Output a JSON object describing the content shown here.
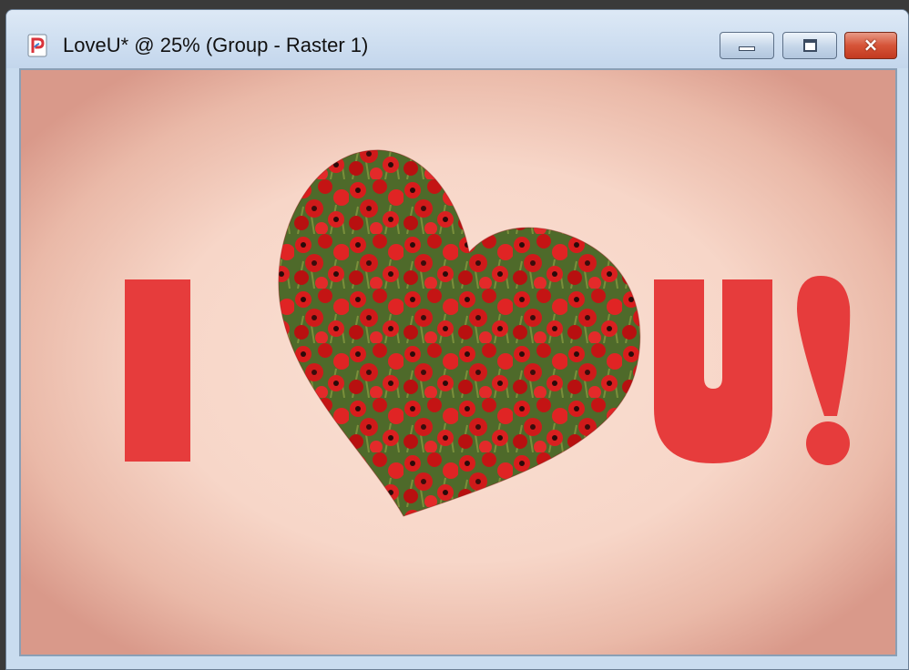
{
  "window": {
    "title": "LoveU* @  25% (Group - Raster 1)"
  },
  "controls": {
    "minimize": "minimize",
    "maximize": "maximize",
    "close": "×"
  },
  "artwork": {
    "left_letter": "I",
    "right_text": "U!",
    "text_color": "#e63c3c",
    "heart_fill": "poppy-field-photo",
    "background": "peach-vignette"
  }
}
